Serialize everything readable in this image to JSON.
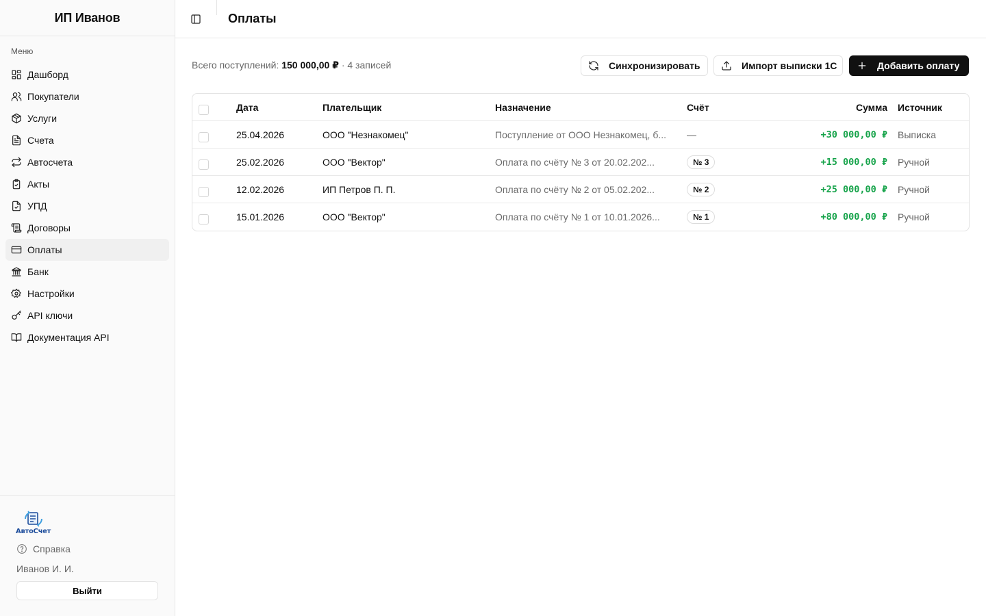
{
  "sidebar": {
    "brand": "ИП Иванов",
    "menu_label": "Меню",
    "items": [
      {
        "label": "Дашборд",
        "icon": "dashboard-icon"
      },
      {
        "label": "Покупатели",
        "icon": "users-icon"
      },
      {
        "label": "Услуги",
        "icon": "package-icon"
      },
      {
        "label": "Счета",
        "icon": "file-text-icon"
      },
      {
        "label": "Автосчета",
        "icon": "repeat-icon"
      },
      {
        "label": "Акты",
        "icon": "clipboard-check-icon"
      },
      {
        "label": "УПД",
        "icon": "file-check-icon"
      },
      {
        "label": "Договоры",
        "icon": "scroll-icon"
      },
      {
        "label": "Оплаты",
        "icon": "credit-card-icon",
        "active": true
      },
      {
        "label": "Банк",
        "icon": "bank-icon"
      },
      {
        "label": "Настройки",
        "icon": "gear-icon"
      },
      {
        "label": "API ключи",
        "icon": "key-icon"
      },
      {
        "label": "Документация API",
        "icon": "book-icon"
      }
    ],
    "footer": {
      "logo_text": "АвтоСчет",
      "help_label": "Справка",
      "user_name": "Иванов И. И.",
      "logout_label": "Выйти"
    }
  },
  "header": {
    "title": "Оплаты"
  },
  "toolbar": {
    "summary_prefix": "Всего поступлений:",
    "summary_total": "150 000,00 ₽",
    "summary_count": "· 4 записей",
    "sync_label": "Синхронизировать",
    "import_label": "Импорт выписки 1С",
    "add_label": "Добавить оплату"
  },
  "table": {
    "columns": [
      "Дата",
      "Плательщик",
      "Назначение",
      "Счёт",
      "Сумма",
      "Источник"
    ],
    "rows": [
      {
        "date": "25.04.2026",
        "payer": "ООО \"Незнакомец\"",
        "purpose": "Поступление от ООО Незнакомец, б...",
        "invoice": "—",
        "amount": "+30 000,00 ₽",
        "source": "Выписка"
      },
      {
        "date": "25.02.2026",
        "payer": "ООО \"Вектор\"",
        "purpose": "Оплата по счёту № 3 от 20.02.202...",
        "invoice": "№ 3",
        "amount": "+15 000,00 ₽",
        "source": "Ручной"
      },
      {
        "date": "12.02.2026",
        "payer": "ИП Петров П. П.",
        "purpose": "Оплата по счёту № 2 от 05.02.202...",
        "invoice": "№ 2",
        "amount": "+25 000,00 ₽",
        "source": "Ручной"
      },
      {
        "date": "15.01.2026",
        "payer": "ООО \"Вектор\"",
        "purpose": "Оплата по счёту № 1 от 10.01.2026...",
        "invoice": "№ 1",
        "amount": "+80 000,00 ₽",
        "source": "Ручной"
      }
    ]
  },
  "colors": {
    "accent": "#111111",
    "positive_amount": "#16a34a",
    "sidebar_bg": "#fafafa",
    "logo": "#1f4e9c"
  }
}
